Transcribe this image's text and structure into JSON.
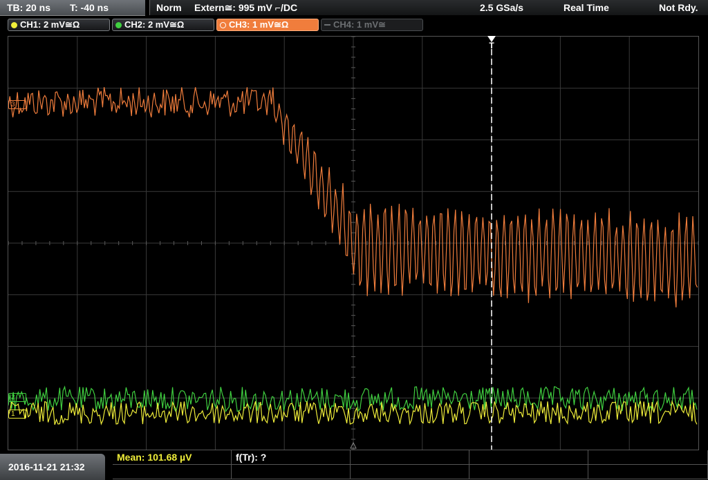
{
  "status": {
    "timebase": "TB: 20 ns",
    "trigger_pos": "T: -40 ns",
    "mode": "Norm",
    "trigger_source": "Extern≅: 995 mV ⌐/DC",
    "sample_rate": "2.5 GSa/s",
    "acq_mode": "Real Time",
    "ready": "Not Rdy."
  },
  "channels": [
    {
      "label": "CH1: 2 mV≅Ω",
      "color": "#f0ee3a",
      "state": "on"
    },
    {
      "label": "CH2: 2 mV≅Ω",
      "color": "#40d040",
      "state": "on"
    },
    {
      "label": "CH3: 1 mV≅Ω",
      "color": "#f07d3c",
      "state": "active"
    },
    {
      "label": "CH4: 1 mV≅",
      "color": "#6c6f72",
      "state": "off"
    }
  ],
  "markers": {
    "ch3": "3",
    "ch2": "2",
    "ch1": "1",
    "trigger": "T"
  },
  "bottom": {
    "datetime": "2016-11-21 21:32",
    "mean": "Mean: 101.68 µV",
    "ftr": "f(Tr): ?"
  },
  "colors": {
    "ch1": "#f0ee3a",
    "ch2": "#40d040",
    "ch3": "#f07d3c",
    "grid": "#3a3a3a",
    "trigger_line": "#ffffff"
  }
}
